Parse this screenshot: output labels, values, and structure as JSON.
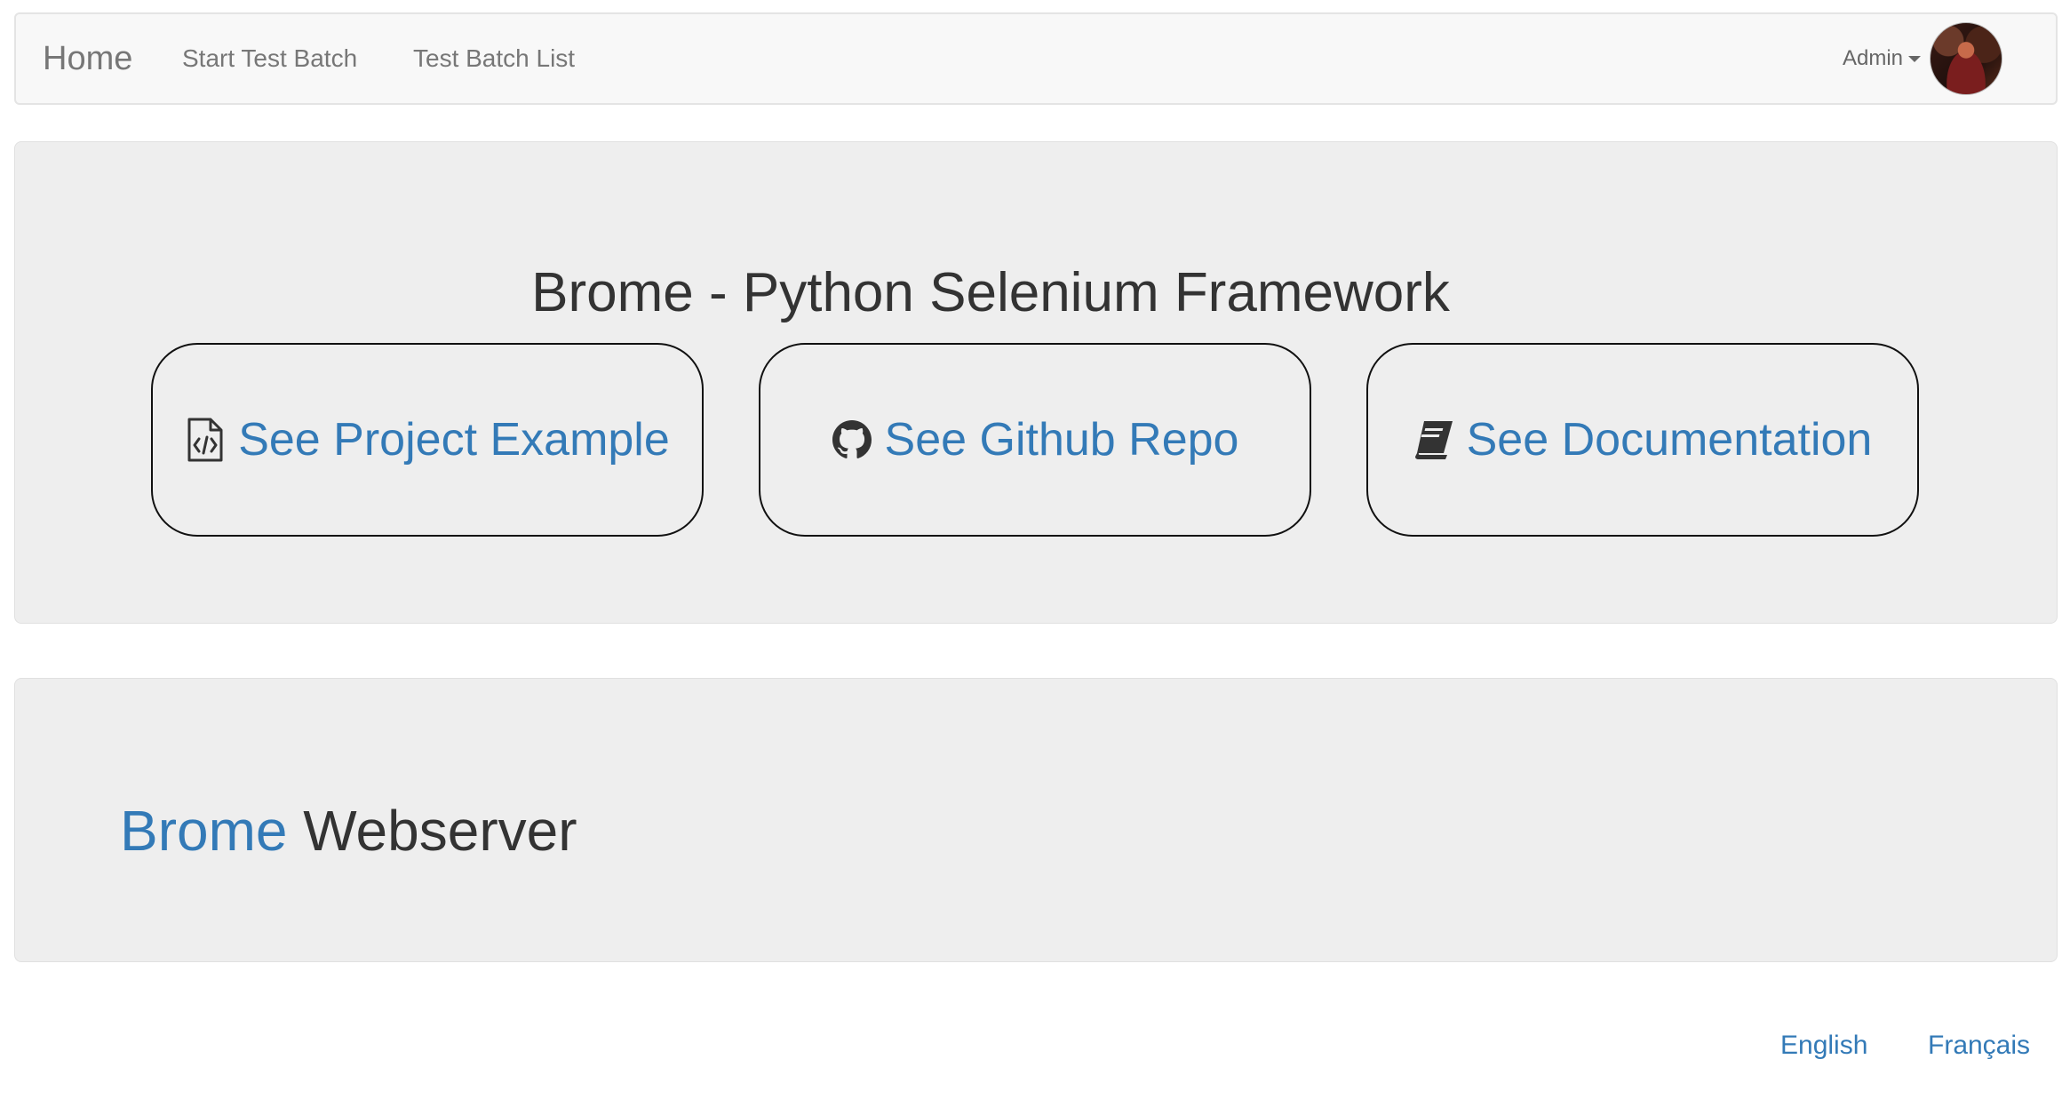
{
  "navbar": {
    "brand": "Home",
    "links": [
      "Start Test Batch",
      "Test Batch List"
    ],
    "user": "Admin"
  },
  "hero": {
    "title": "Brome - Python Selenium Framework",
    "cards": [
      {
        "label": "See Project Example",
        "icon": "file-code-icon"
      },
      {
        "label": "See Github Repo",
        "icon": "github-icon"
      },
      {
        "label": "See Documentation",
        "icon": "book-icon"
      }
    ]
  },
  "panel": {
    "title_accent": "Brome",
    "title_rest": "Webserver"
  },
  "footer": {
    "languages": [
      "English",
      "Français"
    ]
  },
  "colors": {
    "link": "#337ab7",
    "panel_bg": "#eeeeee",
    "navbar_bg": "#f8f8f8",
    "text": "#333333"
  }
}
